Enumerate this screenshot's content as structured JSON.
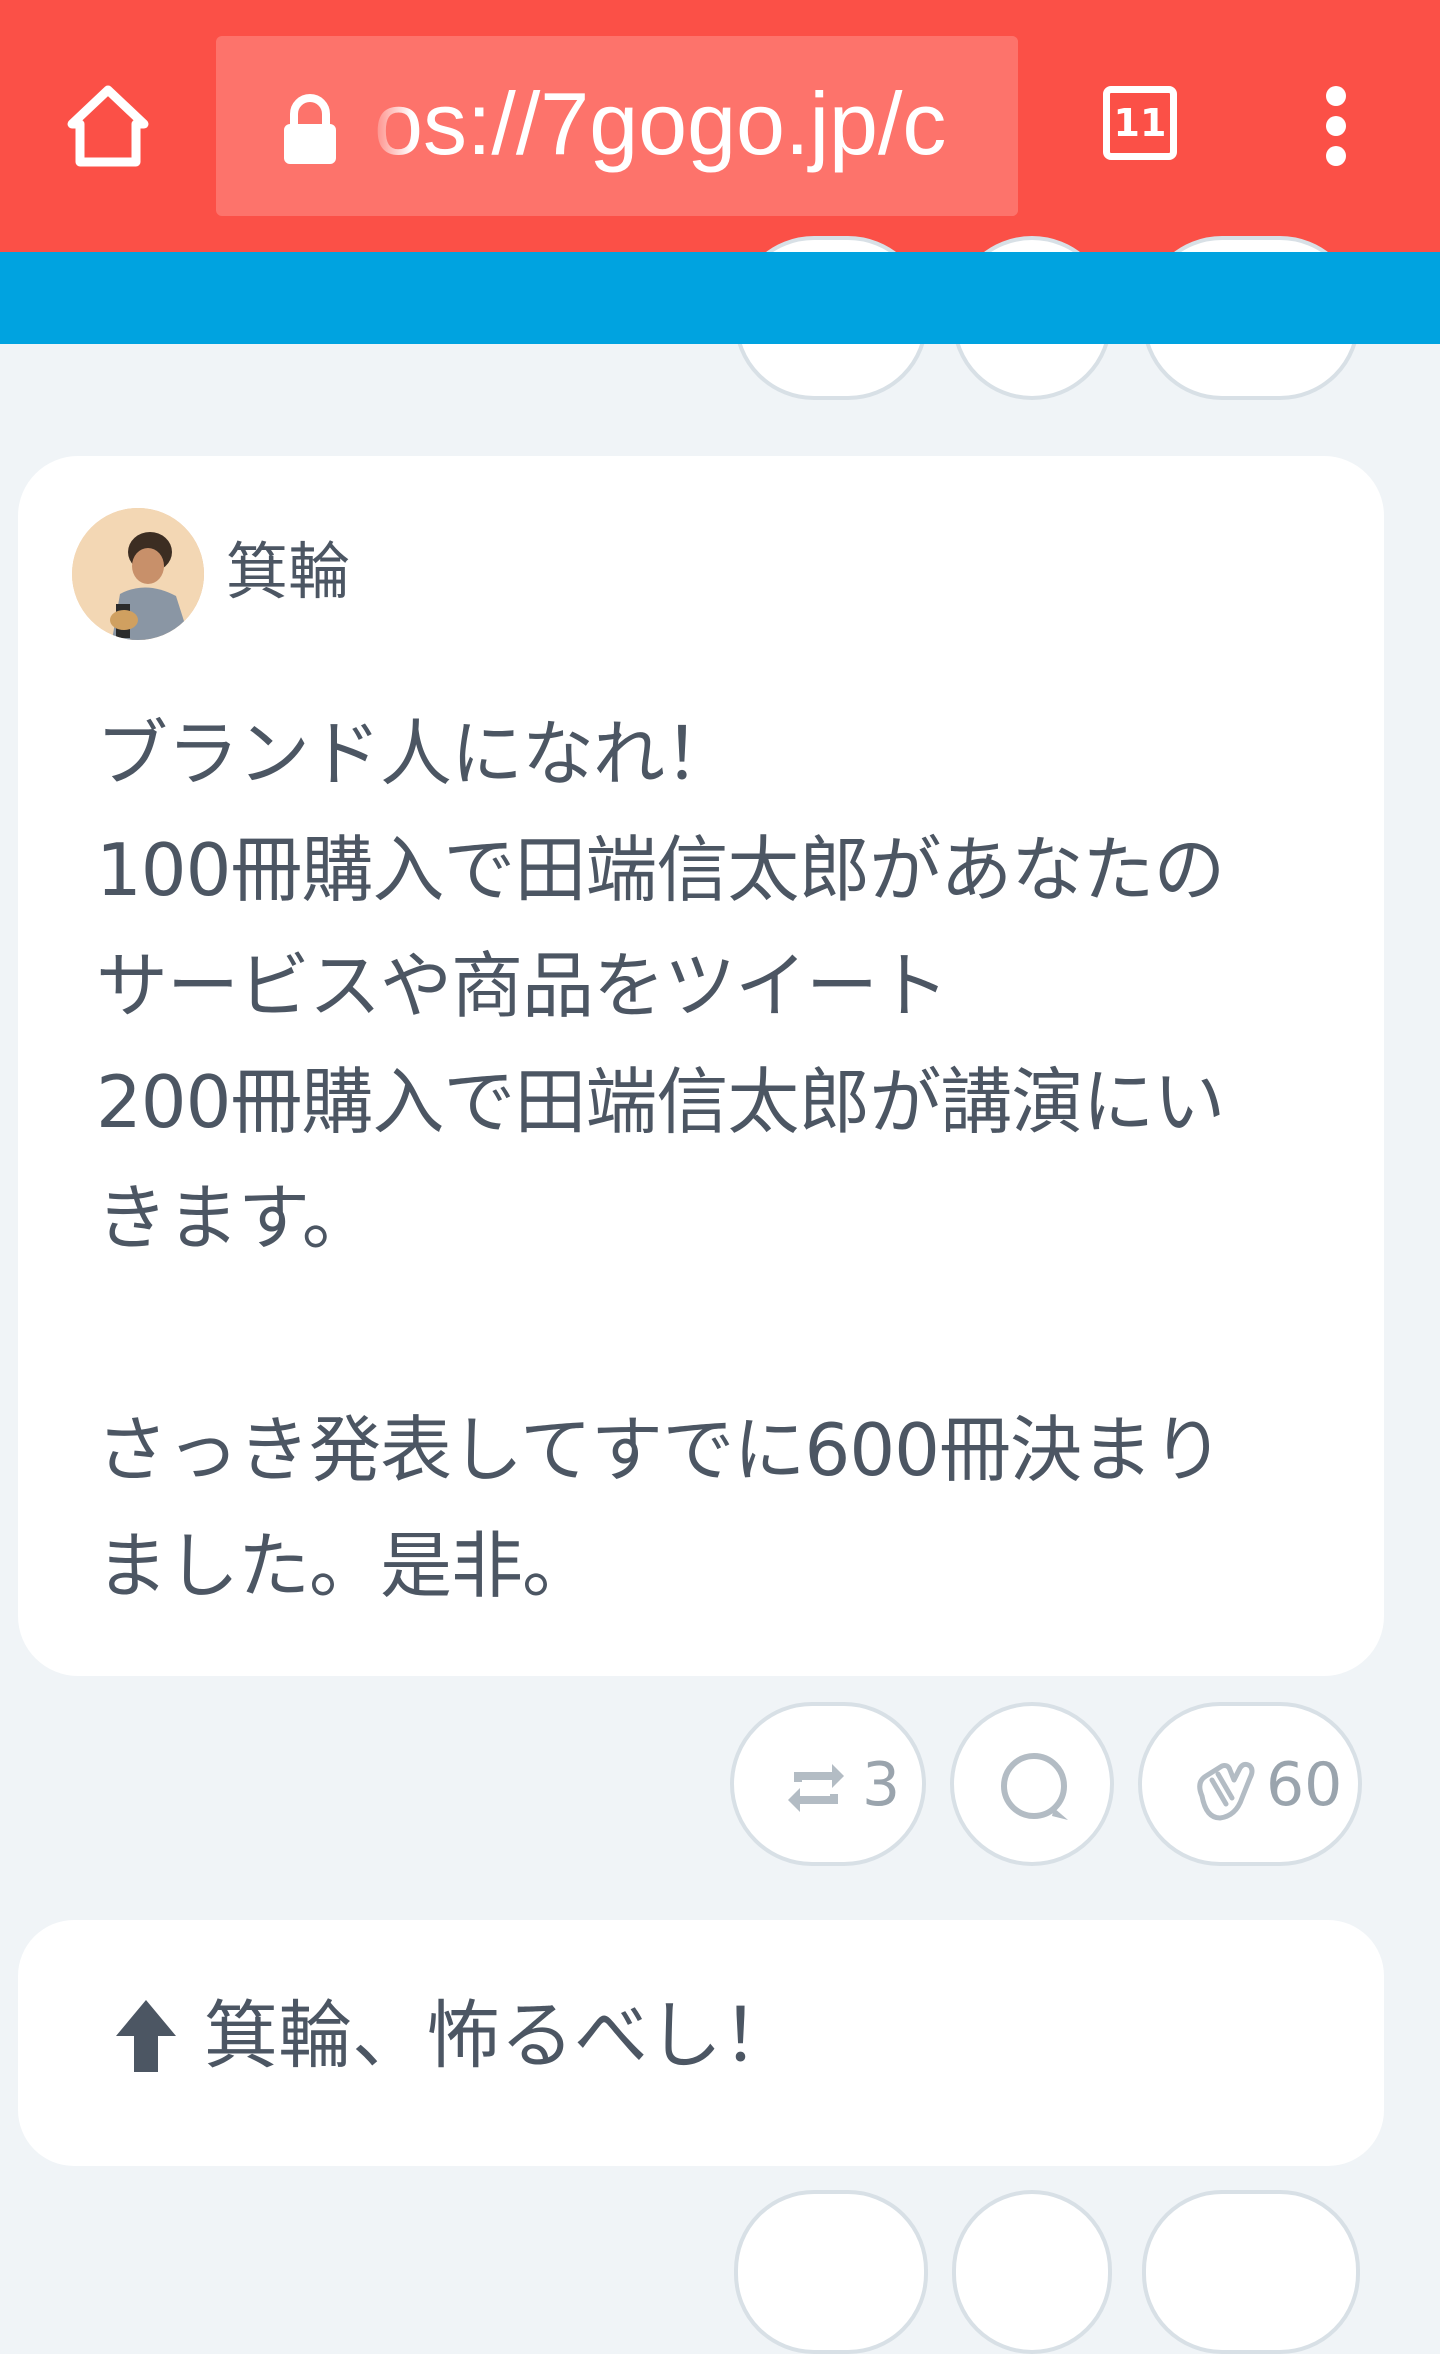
{
  "browser": {
    "url": "https://7gogo.jp/",
    "url_visible": "os://7gogo.jp/c",
    "tab_count": "11",
    "toolbar_color": "#fb5047",
    "header_color": "#00a3e0"
  },
  "post": {
    "author": "箕輪",
    "body": "ブランド人になれ！\n100冊購入で田端信太郎があなたの\nサービスや商品をツイート\n200冊購入で田端信太郎が講演にい\nきます。\n\nさっき発表してすでに600冊決まり\nました。是非。",
    "actions": {
      "repost": {
        "icon": "repost-icon",
        "count": "3"
      },
      "comment": {
        "icon": "comment-icon"
      },
      "clap": {
        "icon": "clap-icon",
        "count": "60"
      }
    }
  },
  "next_post": {
    "icon": "arrow-up-icon",
    "text": "箕輪、怖るべし！"
  }
}
